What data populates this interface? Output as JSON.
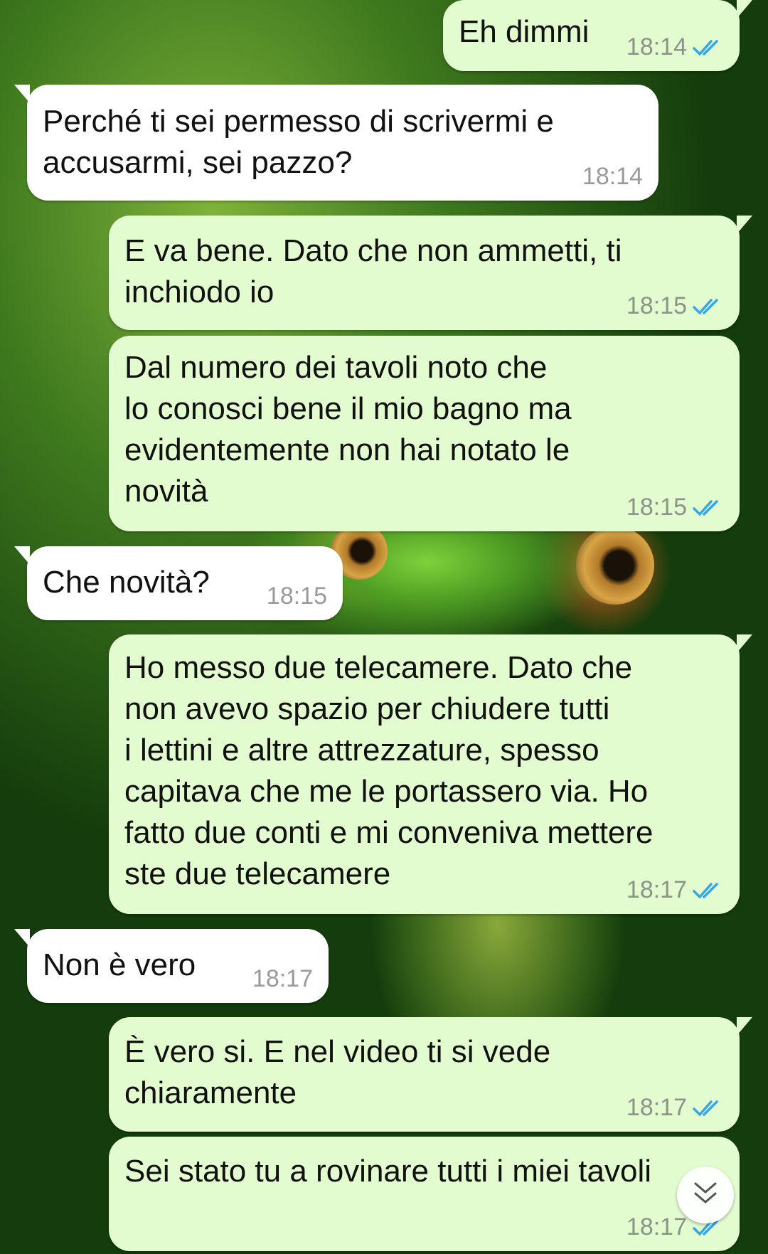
{
  "messages": [
    {
      "text": "Eh dimmi",
      "time": "18:14",
      "direction": "out",
      "status": "read"
    },
    {
      "text": "Perché ti sei permesso di scrivermi e\naccusarmi, sei pazzo?",
      "time": "18:14",
      "direction": "in"
    },
    {
      "text": "E va bene. Dato che non ammetti, ti\ninchiodo io",
      "time": "18:15",
      "direction": "out",
      "status": "read"
    },
    {
      "text": "Dal numero dei tavoli noto che\nlo conosci bene il mio bagno ma\nevidentemente non hai notato le\nnovità",
      "time": "18:15",
      "direction": "out",
      "status": "read"
    },
    {
      "text": "Che novità?",
      "time": "18:15",
      "direction": "in"
    },
    {
      "text": "Ho messo due telecamere. Dato che\nnon avevo spazio per chiudere tutti\ni lettini e altre attrezzature, spesso\ncapitava che me le portassero via. Ho\nfatto due conti e mi conveniva mettere\nste due telecamere",
      "time": "18:17",
      "direction": "out",
      "status": "read"
    },
    {
      "text": "Non è vero",
      "time": "18:17",
      "direction": "in"
    },
    {
      "text": "È vero si. E nel video ti si vede\nchiaramente",
      "time": "18:17",
      "direction": "out",
      "status": "read"
    },
    {
      "text": "Sei stato tu a rovinare tutti i miei tavoli",
      "time": "18:17",
      "direction": "out",
      "status": "read"
    }
  ],
  "icons": {
    "read_receipt": "double-check-icon",
    "scroll_down": "chevron-double-down-icon"
  },
  "colors": {
    "outgoing_bubble": "#e2fccf",
    "incoming_bubble": "#ffffff",
    "read_check": "#35a6e8",
    "timestamp": "#8c948a"
  }
}
